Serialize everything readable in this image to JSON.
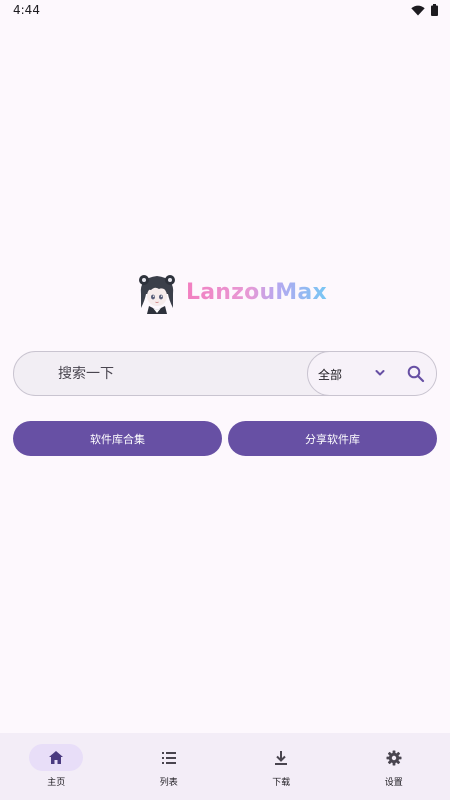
{
  "status_bar": {
    "time": "4:44"
  },
  "logo": {
    "title": "LanzouMax"
  },
  "search": {
    "placeholder": "搜索一下",
    "scope_selected": "全部"
  },
  "actions": {
    "software_collection": "软件库合集",
    "share_software": "分享软件库"
  },
  "nav": {
    "items": [
      {
        "label": "主页",
        "icon": "home-icon",
        "active": true
      },
      {
        "label": "列表",
        "icon": "list-icon",
        "active": false
      },
      {
        "label": "下载",
        "icon": "download-icon",
        "active": false
      },
      {
        "label": "设置",
        "icon": "gear-icon",
        "active": false
      }
    ]
  },
  "colors": {
    "primary": "#6750a4",
    "background": "#fdf8fd",
    "nav_background": "#f3edf7",
    "active_indicator": "#e8def8"
  }
}
